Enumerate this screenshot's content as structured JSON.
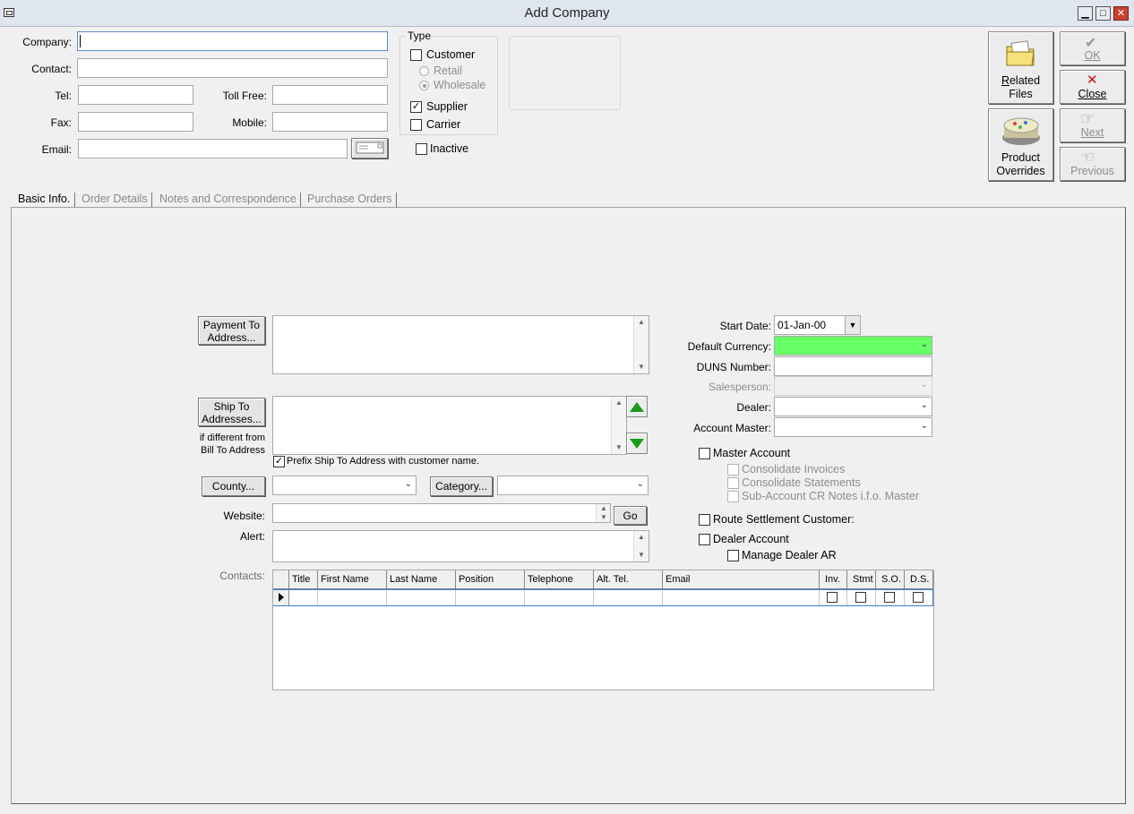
{
  "window": {
    "title": "Add Company",
    "minimize_glyph": "▁",
    "maximize_glyph": "□",
    "close_glyph": "✕"
  },
  "header": {
    "company_label": "Company:",
    "contact_label": "Contact:",
    "tel_label": "Tel:",
    "tollfree_label": "Toll Free:",
    "fax_label": "Fax:",
    "mobile_label": "Mobile:",
    "email_label": "Email:",
    "company_value": "",
    "contact_value": "",
    "tel_value": "",
    "tollfree_value": "",
    "fax_value": "",
    "mobile_value": "",
    "email_value": ""
  },
  "type_group": {
    "legend": "Type",
    "customer": {
      "label": "Customer",
      "checked": false
    },
    "retail": {
      "label": "Retail",
      "selected": false,
      "enabled": false
    },
    "wholesale": {
      "label": "Wholesale",
      "selected": true,
      "enabled": false
    },
    "supplier": {
      "label": "Supplier",
      "checked": true
    },
    "carrier": {
      "label": "Carrier",
      "checked": false
    }
  },
  "inactive": {
    "label": "Inactive",
    "checked": false
  },
  "action_buttons": {
    "related_files": "Related Files",
    "related_files_underline": "R",
    "product_overrides": "Product Overrides",
    "ok": "OK",
    "close": "Close",
    "next": "Next",
    "previous": "Previous"
  },
  "tabs": [
    {
      "label": "Basic Info.",
      "active": true
    },
    {
      "label": "Order Details",
      "active": false
    },
    {
      "label": "Notes and Correspondence",
      "active": false
    },
    {
      "label": "Purchase Orders",
      "active": false
    }
  ],
  "basic": {
    "payment_to_btn": "Payment To Address...",
    "ship_to_btn": "Ship To Addresses...",
    "ship_note": "if different from Bill To Address",
    "prefix_label": "Prefix Ship To Address with customer name.",
    "prefix_checked": true,
    "county_btn": "County...",
    "category_btn": "Category...",
    "website_label": "Website:",
    "go_btn": "Go",
    "alert_label": "Alert:",
    "contacts_label": "Contacts:",
    "start_date_label": "Start Date:",
    "start_date_value": "01-Jan-00",
    "default_currency_label": "Default Currency:",
    "default_currency_value": "",
    "duns_label": "DUNS Number:",
    "salesperson_label": "Salesperson:",
    "dealer_label": "Dealer:",
    "account_master_label": "Account Master:",
    "master_account": {
      "label": "Master Account",
      "checked": false
    },
    "consolidate_invoices": {
      "label": "Consolidate Invoices",
      "checked": false
    },
    "consolidate_statements": {
      "label": "Consolidate Statements",
      "checked": false
    },
    "subaccount_cr": {
      "label": "Sub-Account CR Notes i.f.o. Master",
      "checked": false
    },
    "route_settlement": {
      "label": "Route Settlement Customer:",
      "checked": false
    },
    "dealer_account": {
      "label": "Dealer Account",
      "checked": false
    },
    "manage_dealer_ar": {
      "label": "Manage Dealer AR",
      "checked": false
    }
  },
  "contacts_grid": {
    "columns": [
      "Title",
      "First Name",
      "Last Name",
      "Position",
      "Telephone",
      "Alt. Tel.",
      "Email",
      "Inv.",
      "Stmt",
      "S.O.",
      "D.S."
    ],
    "rows": [
      {
        "Title": "",
        "First Name": "",
        "Last Name": "",
        "Position": "",
        "Telephone": "",
        "Alt. Tel.": "",
        "Email": "",
        "Inv.": false,
        "Stmt": false,
        "S.O.": false,
        "D.S.": false
      }
    ]
  },
  "colors": {
    "currency_highlight": "#66ff66",
    "arrow_green": "#1a9b1a",
    "close_red": "#c7432f"
  }
}
